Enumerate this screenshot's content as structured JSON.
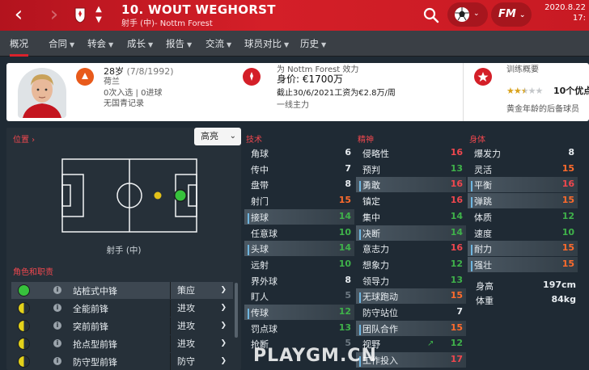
{
  "topbar": {
    "back_icon": "back-arrow-icon",
    "forward_icon": "forward-arrow-icon",
    "player_title": "10. WOUT WEGHORST",
    "player_subtitle": "射手 (中)- Nottm Forest",
    "date_line1": "2020.8.22",
    "date_line2": "17:",
    "fm_label": "FM",
    "accent_color": "#d41f28"
  },
  "tabs": [
    {
      "label": "概况",
      "has_menu": false
    },
    {
      "label": "合同",
      "has_menu": true
    },
    {
      "label": "转会",
      "has_menu": true
    },
    {
      "label": "成长",
      "has_menu": true
    },
    {
      "label": "报告",
      "has_menu": true
    },
    {
      "label": "交流",
      "has_menu": true
    },
    {
      "label": "球员对比",
      "has_menu": true
    },
    {
      "label": "历史",
      "has_menu": true
    }
  ],
  "tab_caret": "▼",
  "overview": {
    "age": "28岁",
    "dob": "(7/8/1992)",
    "nationality": "荷兰",
    "caps": "0次入选 | 0进球",
    "youth": "无国青记录",
    "club": "为 Nottm Forest 效力",
    "value": "身价: €1700万",
    "contract": "截止30/6/2021工资为€2.8万/周",
    "squad_role": "一线主力",
    "training_header": "训练概要",
    "stars_full": 2.5,
    "best_position": "10个优点",
    "prospect": "黄金年龄的后备球员"
  },
  "left_panel": {
    "position_title": "位置 ›",
    "highlight_label": "高亮",
    "position_label": "射手 (中)",
    "roles_title": "角色和职责",
    "roles": [
      {
        "name": "站桩式中锋",
        "duty": "策应",
        "dot": "full"
      },
      {
        "name": "全能前锋",
        "duty": "进攻",
        "dot": "half"
      },
      {
        "name": "突前前锋",
        "duty": "进攻",
        "dot": "half"
      },
      {
        "name": "抢点型前锋",
        "duty": "进攻",
        "dot": "half"
      },
      {
        "name": "防守型前锋",
        "duty": "防守",
        "dot": "half"
      }
    ]
  },
  "attributes": {
    "technical_title": "技术",
    "mental_title": "精神",
    "physical_title": "身体",
    "technical": [
      {
        "name": "角球",
        "value": "6",
        "hl": false
      },
      {
        "name": "传中",
        "value": "7",
        "hl": false
      },
      {
        "name": "盘带",
        "value": "8",
        "hl": false
      },
      {
        "name": "射门",
        "value": "15",
        "hl": false
      },
      {
        "name": "接球",
        "value": "14",
        "hl": true
      },
      {
        "name": "任意球",
        "value": "10",
        "hl": false
      },
      {
        "name": "头球",
        "value": "14",
        "hl": true
      },
      {
        "name": "远射",
        "value": "10",
        "hl": false
      },
      {
        "name": "界外球",
        "value": "8",
        "hl": false
      },
      {
        "name": "盯人",
        "value": "5",
        "hl": false
      },
      {
        "name": "传球",
        "value": "12",
        "hl": true
      },
      {
        "name": "罚点球",
        "value": "13",
        "hl": false
      },
      {
        "name": "抢断",
        "value": "5",
        "hl": false
      }
    ],
    "mental": [
      {
        "name": "侵略性",
        "value": "16",
        "hl": false
      },
      {
        "name": "预判",
        "value": "13",
        "hl": false
      },
      {
        "name": "勇敢",
        "value": "16",
        "hl": true
      },
      {
        "name": "镇定",
        "value": "16",
        "hl": false
      },
      {
        "name": "集中",
        "value": "14",
        "hl": false
      },
      {
        "name": "决断",
        "value": "14",
        "hl": true
      },
      {
        "name": "意志力",
        "value": "16",
        "hl": false
      },
      {
        "name": "想象力",
        "value": "12",
        "hl": false
      },
      {
        "name": "领导力",
        "value": "13",
        "hl": false
      },
      {
        "name": "无球跑动",
        "value": "15",
        "hl": true
      },
      {
        "name": "防守站位",
        "value": "7",
        "hl": false
      },
      {
        "name": "团队合作",
        "value": "15",
        "hl": true
      },
      {
        "name": "视野",
        "value": "12",
        "hl": false
      },
      {
        "name": "工作投入",
        "value": "17",
        "hl": true
      }
    ],
    "physical": [
      {
        "name": "爆发力",
        "value": "8",
        "hl": false
      },
      {
        "name": "灵活",
        "value": "15",
        "hl": false
      },
      {
        "name": "平衡",
        "value": "16",
        "hl": true
      },
      {
        "name": "弹跳",
        "value": "15",
        "hl": true
      },
      {
        "name": "体质",
        "value": "12",
        "hl": false
      },
      {
        "name": "速度",
        "value": "10",
        "hl": false
      },
      {
        "name": "耐力",
        "value": "15",
        "hl": true
      },
      {
        "name": "强壮",
        "value": "15",
        "hl": true
      }
    ],
    "height_label": "身高",
    "height_value": "197cm",
    "weight_label": "体重",
    "weight_value": "84kg"
  },
  "watermark": "PLAYGM.CN"
}
